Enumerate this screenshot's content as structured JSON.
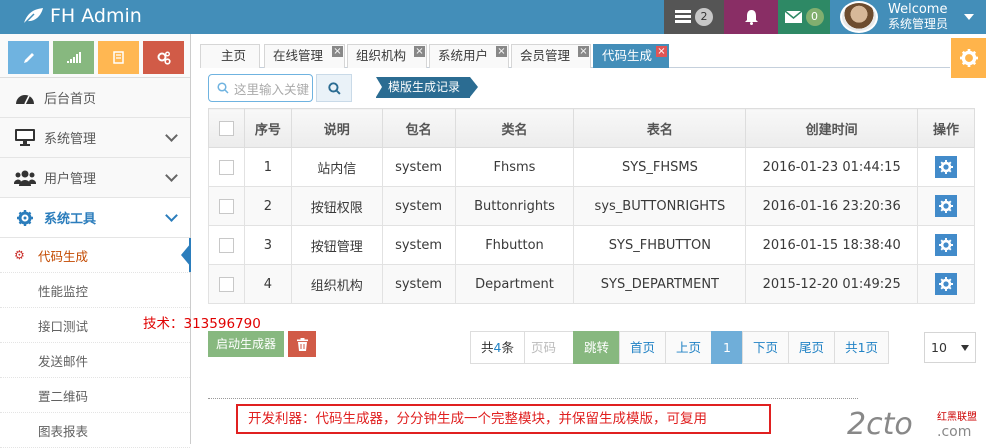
{
  "app": {
    "brand": "FH Admin"
  },
  "navbar": {
    "tasks_count": "2",
    "mail_count": "0",
    "user": {
      "welcome": "Welcome",
      "name": "系统管理员"
    }
  },
  "sidebar": {
    "shortcuts": [
      {
        "icon": "pencil-icon",
        "color": "#6fb3e0"
      },
      {
        "icon": "signal-icon",
        "color": "#87b87f"
      },
      {
        "icon": "book-icon",
        "color": "#ffb752"
      },
      {
        "icon": "cogs-icon",
        "color": "#d15b47"
      }
    ],
    "menu": [
      {
        "label": "后台首页",
        "icon": "dashboard-icon"
      },
      {
        "label": "系统管理",
        "icon": "desktop-icon"
      },
      {
        "label": "用户管理",
        "icon": "users-icon"
      },
      {
        "label": "系统工具",
        "icon": "cog-icon"
      }
    ],
    "submenu": [
      "代码生成",
      "性能监控",
      "接口测试",
      "发送邮件",
      "置二维码",
      "图表报表"
    ]
  },
  "tabs": [
    "主页",
    "在线管理",
    "组织机构",
    "系统用户",
    "会员管理",
    "代码生成"
  ],
  "toolbar": {
    "search_placeholder": "这里输入关键",
    "record_label": "模版生成记录"
  },
  "table": {
    "headers": [
      "",
      "序号",
      "说明",
      "包名",
      "类名",
      "表名",
      "创建时间",
      "操作"
    ],
    "rows": [
      {
        "no": "1",
        "desc": "站内信",
        "pkg": "system",
        "cls": "Fhsms",
        "tbl": "SYS_FHSMS",
        "time": "2016-01-23 01:44:15"
      },
      {
        "no": "2",
        "desc": "按钮权限",
        "pkg": "system",
        "cls": "Buttonrights",
        "tbl": "sys_BUTTONRIGHTS",
        "time": "2016-01-16 23:20:36"
      },
      {
        "no": "3",
        "desc": "按钮管理",
        "pkg": "system",
        "cls": "Fhbutton",
        "tbl": "SYS_FHBUTTON",
        "time": "2016-01-15 18:38:40"
      },
      {
        "no": "4",
        "desc": "组织机构",
        "pkg": "system",
        "cls": "Department",
        "tbl": "SYS_DEPARTMENT",
        "time": "2015-12-20 01:49:25"
      }
    ]
  },
  "actions": {
    "generate_label": "启动生成器"
  },
  "tech_note": "技术：313596790",
  "pagination": {
    "total_prefix": "共",
    "total_count": "4",
    "total_suffix": "条",
    "page_input_placeholder": "页码",
    "go_label": "跳转",
    "first": "首页",
    "prev": "上页",
    "current": "1",
    "next": "下页",
    "last": "尾页",
    "pages_label": "共1页",
    "page_size": "10"
  },
  "footer_note": "开发利器：代码生成器，分分钟生成一个完整模块，并保留生成模版，可复用",
  "watermark": {
    "logo": "2cto",
    "domain": ".com",
    "tag": "红黑联盟"
  },
  "colors": {
    "navbar": "#438eb9",
    "accent_blue": "#2b7dbc",
    "success": "#87b87f",
    "danger": "#d15b47",
    "warning": "#ffb752"
  }
}
